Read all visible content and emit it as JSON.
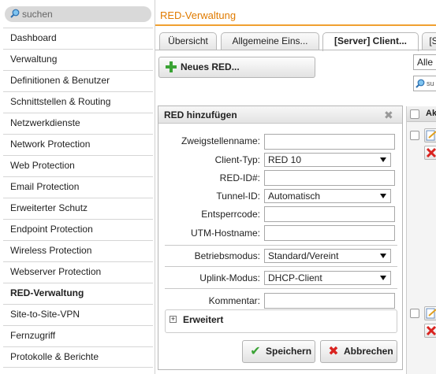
{
  "search": {
    "placeholder": "suchen"
  },
  "sidebar": {
    "items": [
      {
        "label": "Dashboard",
        "active": false
      },
      {
        "label": "Verwaltung",
        "active": false
      },
      {
        "label": "Definitionen & Benutzer",
        "active": false
      },
      {
        "label": "Schnittstellen & Routing",
        "active": false
      },
      {
        "label": "Netzwerkdienste",
        "active": false
      },
      {
        "label": "Network Protection",
        "active": false
      },
      {
        "label": "Web Protection",
        "active": false
      },
      {
        "label": "Email Protection",
        "active": false
      },
      {
        "label": "Erweiterter Schutz",
        "active": false
      },
      {
        "label": "Endpoint Protection",
        "active": false
      },
      {
        "label": "Wireless Protection",
        "active": false
      },
      {
        "label": "Webserver Protection",
        "active": false
      },
      {
        "label": "RED-Verwaltung",
        "active": true
      },
      {
        "label": "Site-to-Site-VPN",
        "active": false
      },
      {
        "label": "Fernzugriff",
        "active": false
      },
      {
        "label": "Protokolle & Berichte",
        "active": false
      }
    ]
  },
  "header": {
    "title": "RED-Verwaltung"
  },
  "tabs": [
    {
      "label": "Übersicht",
      "active": false
    },
    {
      "label": "Allgemeine Eins...",
      "active": false
    },
    {
      "label": "[Server] Client...",
      "active": true
    },
    {
      "label": "[S",
      "active": false
    }
  ],
  "toolbar": {
    "new_red_label": "Neues RED..."
  },
  "right_panel": {
    "filter_value": "Alle",
    "search_placeholder": "su",
    "column_header": "Ak"
  },
  "dialog": {
    "title": "RED hinzufügen",
    "fields": {
      "branch_name": {
        "label": "Zweigstellenname:",
        "value": ""
      },
      "client_type": {
        "label": "Client-Typ:",
        "value": "RED 10"
      },
      "red_id": {
        "label": "RED-ID#:",
        "value": ""
      },
      "tunnel_id": {
        "label": "Tunnel-ID:",
        "value": "Automatisch"
      },
      "unlock_code": {
        "label": "Entsperrcode:",
        "value": ""
      },
      "utm_hostname": {
        "label": "UTM-Hostname:",
        "value": ""
      },
      "operation_mode": {
        "label": "Betriebsmodus:",
        "value": "Standard/Vereint"
      },
      "uplink_mode": {
        "label": "Uplink-Modus:",
        "value": "DHCP-Client"
      },
      "comment": {
        "label": "Kommentar:",
        "value": ""
      }
    },
    "advanced_label": "Erweitert",
    "save_label": "Speichern",
    "cancel_label": "Abbrechen"
  },
  "colors": {
    "accent": "#e07b00",
    "header_underline": "#f0a030",
    "save_icon": "#3aa335",
    "cancel_icon": "#d9231f",
    "plus_icon": "#3aa335"
  }
}
